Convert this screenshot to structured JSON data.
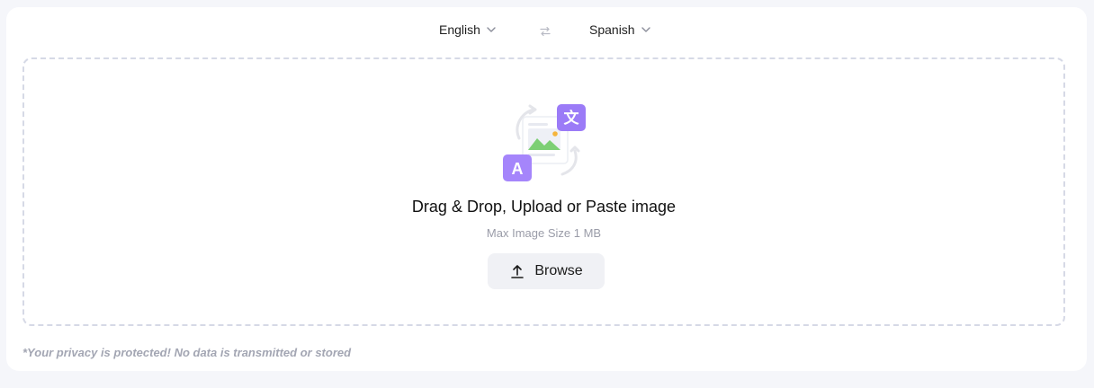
{
  "lang_bar": {
    "source_language": "English",
    "target_language": "Spanish"
  },
  "dropzone": {
    "headline": "Drag & Drop, Upload or Paste image",
    "subline": "Max Image Size 1 MB",
    "browse_label": "Browse",
    "illustration_glyphs": {
      "source_letter": "A",
      "target_glyph": "文"
    }
  },
  "footer": {
    "privacy_note": "*Your privacy is protected! No data is transmitted or stored"
  },
  "colors": {
    "accent": "#9b7bf7",
    "dashed_border": "#d6d9e6",
    "button_bg": "#f0f1f5",
    "muted_text": "#9a9ca8"
  },
  "icons": [
    "chevron-down-icon",
    "swap-icon",
    "upload-icon",
    "translate-image-illustration"
  ]
}
